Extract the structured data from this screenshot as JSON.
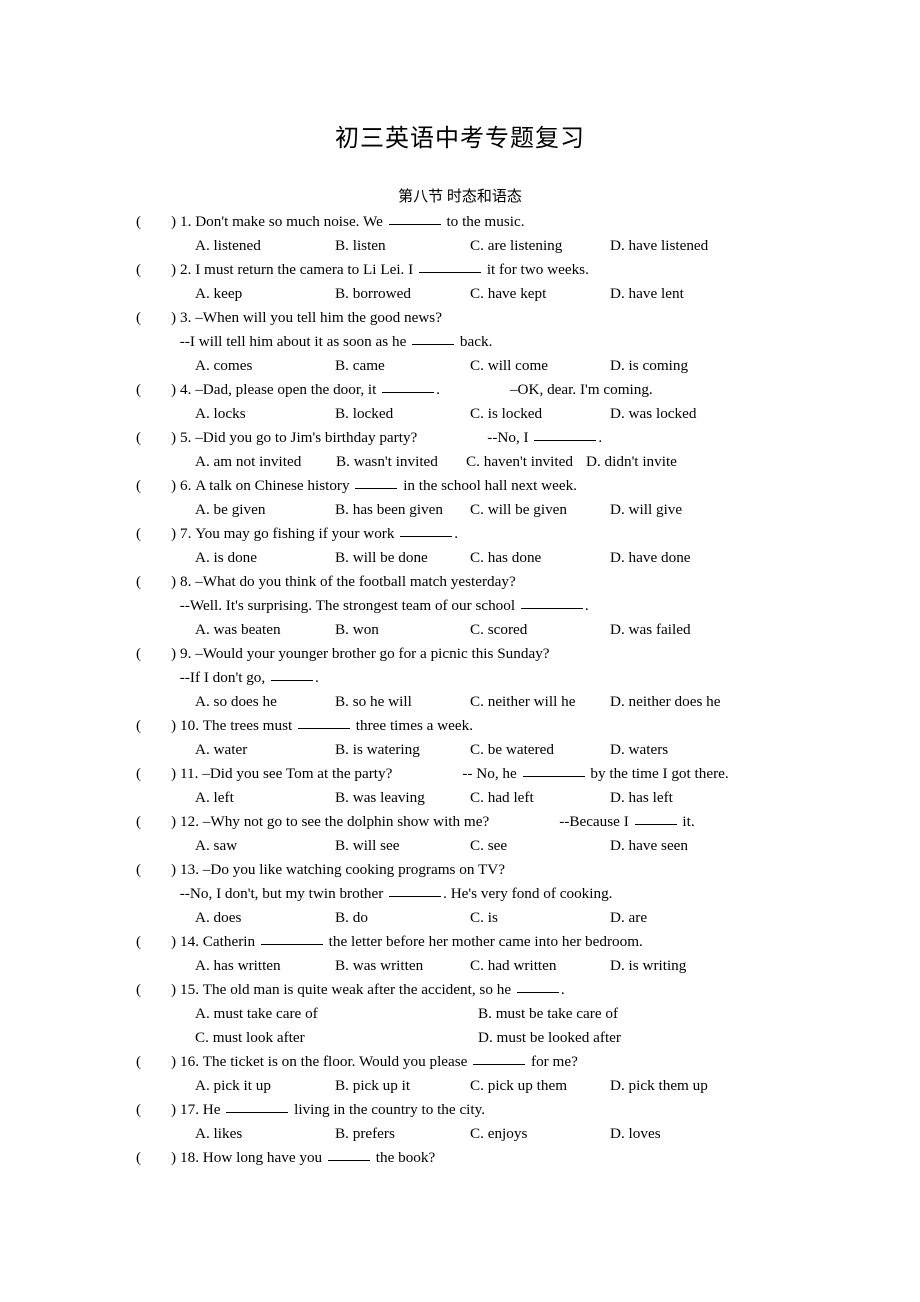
{
  "document": {
    "title": "初三英语中考专题复习",
    "subtitle": "第八节 时态和语态",
    "paren_open": "(",
    "paren_close": ")"
  },
  "questions": [
    {
      "number": "1.",
      "lines": [
        {
          "parts": [
            "Don't make so much noise. We",
            "BLANK",
            "to the music."
          ]
        }
      ],
      "options": [
        "A. listened",
        "B. listen",
        "C. are listening",
        "D. have listened"
      ],
      "layout": "cols4"
    },
    {
      "number": "2.",
      "lines": [
        {
          "parts": [
            "I must return the camera to Li Lei. I",
            "BLANK",
            "it for two weeks."
          ]
        }
      ],
      "options": [
        "A. keep",
        "B. borrowed",
        "C. have kept",
        "D. have lent"
      ],
      "layout": "cols4"
    },
    {
      "number": "3.",
      "lines": [
        {
          "parts": [
            "–When will you tell him the good news?"
          ]
        },
        {
          "parts": [
            "--I will tell him about it as soon as he",
            "BLANK",
            "back."
          ],
          "indent": true
        }
      ],
      "options": [
        "A. comes",
        "B. came",
        "C. will come",
        "D. is coming"
      ],
      "layout": "cols4"
    },
    {
      "number": "4.",
      "lines": [
        {
          "parts": [
            "–Dad, please open the door, it",
            "BLANK",
            ".",
            "GAP",
            "–OK, dear. I'm coming."
          ]
        }
      ],
      "options": [
        "A. locks",
        "B. locked",
        "C. is locked",
        "D. was locked"
      ],
      "layout": "cols4"
    },
    {
      "number": "5.",
      "lines": [
        {
          "parts": [
            "–Did you go to Jim's birthday party?",
            "GAP",
            "--No, I",
            "BLANK",
            "."
          ]
        }
      ],
      "options": [
        "A. am not invited",
        "B. wasn't invited",
        "C. haven't invited",
        "D. didn't invite"
      ],
      "layout": "cols4tight"
    },
    {
      "number": "6.",
      "lines": [
        {
          "parts": [
            "A talk on Chinese history",
            "BLANK",
            "in the school hall next week."
          ]
        }
      ],
      "options": [
        "A. be given",
        "B. has been given",
        "C. will be given",
        "D. will give"
      ],
      "layout": "cols4"
    },
    {
      "number": "7.",
      "lines": [
        {
          "parts": [
            "You may go fishing if your work",
            "BLANK",
            "."
          ]
        }
      ],
      "options": [
        "A. is done",
        "B. will be done",
        "C. has done",
        "D. have done"
      ],
      "layout": "cols4"
    },
    {
      "number": "8.",
      "lines": [
        {
          "parts": [
            "–What do you think of the football match yesterday?"
          ]
        },
        {
          "parts": [
            "--Well. It's surprising. The strongest team of our school",
            "BLANK",
            "."
          ],
          "indent": true
        }
      ],
      "options": [
        "A. was beaten",
        "B. won",
        "C. scored",
        "D. was failed"
      ],
      "layout": "cols4"
    },
    {
      "number": "9.",
      "lines": [
        {
          "parts": [
            "–Would your younger brother go for a picnic this Sunday?"
          ]
        },
        {
          "parts": [
            "--If I don't go,",
            "BLANK",
            "."
          ],
          "indent": true
        }
      ],
      "options": [
        "A. so does he",
        "B. so he will",
        "C. neither will he",
        "D. neither does he"
      ],
      "layout": "cols4"
    },
    {
      "number": "10.",
      "lines": [
        {
          "parts": [
            "The trees must",
            "BLANK",
            "three times a week."
          ]
        }
      ],
      "options": [
        "A. water",
        "B. is watering",
        "C. be watered",
        "D. waters"
      ],
      "layout": "cols4"
    },
    {
      "number": "11.",
      "lines": [
        {
          "parts": [
            "–Did you see Tom at the party?",
            "GAP",
            "-- No, he",
            "BLANK",
            "by the time I got there."
          ]
        }
      ],
      "options": [
        "A. left",
        "B. was leaving",
        "C. had left",
        "D. has left"
      ],
      "layout": "cols4"
    },
    {
      "number": "12.",
      "lines": [
        {
          "parts": [
            "–Why not go to see the dolphin show with me?",
            "GAP",
            "--Because I",
            "BLANK",
            "it."
          ]
        }
      ],
      "options": [
        "A. saw",
        "B. will see",
        "C. see",
        "D. have seen"
      ],
      "layout": "cols4"
    },
    {
      "number": "13.",
      "lines": [
        {
          "parts": [
            "–Do you like watching cooking programs on TV?"
          ]
        },
        {
          "parts": [
            "--No, I don't, but my twin brother",
            "BLANK",
            ". He's very fond of cooking."
          ],
          "indent": true
        }
      ],
      "options": [
        "A. does",
        "B. do",
        "C. is",
        "D. are"
      ],
      "layout": "cols4"
    },
    {
      "number": "14.",
      "lines": [
        {
          "parts": [
            "Catherin",
            "BLANK",
            "the letter before her mother came into her bedroom."
          ]
        }
      ],
      "options": [
        "A. has written",
        "B. was written",
        "C. had written",
        "D. is writing"
      ],
      "layout": "cols4"
    },
    {
      "number": "15.",
      "lines": [
        {
          "parts": [
            "The old man is quite weak after the accident, so he",
            "BLANK",
            "."
          ]
        }
      ],
      "options": [
        "A. must take care of",
        "B. must be take care of",
        "C. must look after",
        "D. must be looked after"
      ],
      "layout": "cols2"
    },
    {
      "number": "16.",
      "lines": [
        {
          "parts": [
            "The ticket is on the floor. Would you please",
            "BLANK",
            "for me?"
          ]
        }
      ],
      "options": [
        "A. pick it up",
        "B. pick up it",
        "C. pick up them",
        "D. pick them up"
      ],
      "layout": "cols4"
    },
    {
      "number": "17.",
      "lines": [
        {
          "parts": [
            "He",
            "BLANK",
            "living in the country to the city."
          ]
        }
      ],
      "options": [
        "A. likes",
        "B. prefers",
        "C. enjoys",
        "D. loves"
      ],
      "layout": "cols4"
    },
    {
      "number": "18.",
      "lines": [
        {
          "parts": [
            "How long have you",
            "BLANK",
            "the book?"
          ]
        }
      ],
      "options": [],
      "layout": "none"
    }
  ]
}
